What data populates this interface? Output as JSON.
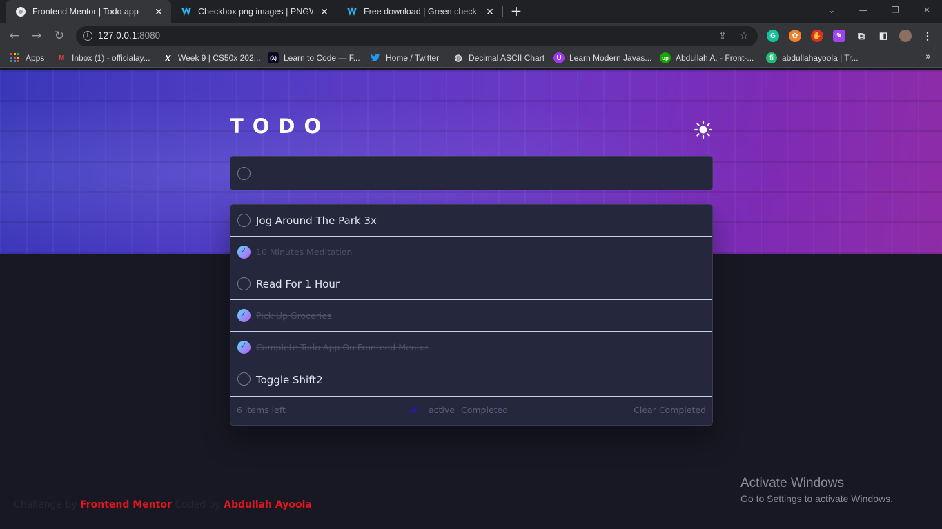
{
  "browser": {
    "tabs": [
      {
        "title": "Frontend Mentor | Todo app",
        "active": true
      },
      {
        "title": "Checkbox png images | PNGWing",
        "active": false
      },
      {
        "title": "Free download | Green check illus",
        "active": false
      }
    ],
    "url_host": "127.0.0.1",
    "url_port": ":8080",
    "bookmarks": [
      {
        "label": "Apps",
        "icon": "apps-grid-icon"
      },
      {
        "label": "Inbox (1) - officialay...",
        "icon": "gmail-icon"
      },
      {
        "label": "Week 9 | CS50x 202...",
        "icon": "x-logo-icon"
      },
      {
        "label": "Learn to Code — F...",
        "icon": "freecodecamp-icon"
      },
      {
        "label": "Home / Twitter",
        "icon": "twitter-icon"
      },
      {
        "label": "Decimal ASCII Chart",
        "icon": "globe-icon"
      },
      {
        "label": "Learn Modern Javas...",
        "icon": "u-logo-icon"
      },
      {
        "label": "Abdullah A. - Front-...",
        "icon": "upwork-icon"
      },
      {
        "label": "abdullahayoola | Tr...",
        "icon": "fiverr-icon"
      }
    ]
  },
  "app": {
    "title": "TODO",
    "new_todo_placeholder": "",
    "todos": [
      {
        "text": "Jog Around The Park 3x",
        "completed": false
      },
      {
        "text": "10 Minutes Meditation",
        "completed": true
      },
      {
        "text": "Read For 1 Hour",
        "completed": false
      },
      {
        "text": "Pick Up Groceries",
        "completed": true
      },
      {
        "text": "Complete Todo App On Frontend Mentor",
        "completed": true
      },
      {
        "text": "Toggle Shift2",
        "completed": false
      }
    ],
    "items_left": "6 items left",
    "filters": {
      "all": "All",
      "active": "active",
      "completed": "Completed"
    },
    "clear_completed": "Clear Completed"
  },
  "attribution": {
    "prefix": "Challenge by",
    "link1": "Frontend Mentor",
    "middle": "Coded by",
    "link2": "Abdullah Ayoola"
  },
  "windows_watermark": {
    "heading": "Activate Windows",
    "sub": "Go to Settings to activate Windows."
  },
  "colors": {
    "accent_link": "#e0161b",
    "filter_active": "#1a1ae8",
    "check_gradient_from": "#57ddff",
    "check_gradient_to": "#c058f3"
  }
}
